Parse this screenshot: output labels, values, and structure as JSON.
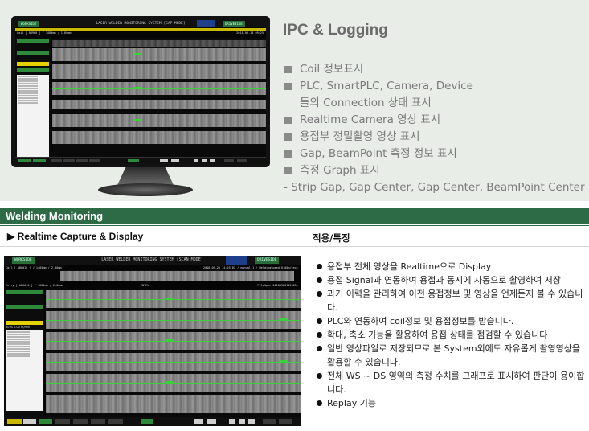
{
  "ipc": {
    "title": "IPC & Logging",
    "items": [
      "Coil 정보표시",
      "PLC, SmartPLC, Camera, Device",
      "들의 Connection 상태 표시",
      "Realtime Camera 영상 표시",
      "용접부 정밀촬영 영상 표시",
      "Gap, BeamPoint 측정 정보 표시",
      "측정 Graph 표시"
    ],
    "subitem": "- Strip Gap, Gap Center, Gap Center, BeamPoint Center"
  },
  "section": {
    "title": "Welding Monitoring",
    "left_subtitle": "▶ Realtime Capture & Display",
    "right_subtitle": "적용/특징"
  },
  "features": [
    "용접부 전체 영상을 Realtime으로 Display",
    "용접 Signal과 연동하여 용접과 동시에 자동으로 촬영하여 저장",
    "과거 이력을 관리하여 이전 용접정보 및 영상을 언제든지 볼 수 있습니다.",
    "PLC와 연동하여 coil정보 및 용접정보를 받습니다.",
    "확대, 축소 기능을 활용하여 용접 상태를 점검할 수 있습니다",
    "일반 영상파일로 저장되므로 본 System외에도 자유롭게 촬영영상을 활용할 수 있습니다.",
    "전체 WS ~ DS 영역의 측정 수치를 그래프로 표시하여 판단이 용이합니다.",
    "Replay 기능"
  ],
  "screen1": {
    "left_tag": "WORKSIDE",
    "right_tag": "DRIVESIDE",
    "title": "LASER WELDER MONITORING SYSTEM [GAP MODE]",
    "info_left": "Coil [ 03960 ] / 1400mm / 1.60mm",
    "info_right": "2018-09-18 09:25"
  },
  "screen2": {
    "left_tag": "WORKSIDE",
    "right_tag": "DRIVESIDE",
    "title": "LASER WELDER MONITORING SYSTEM [SCAN MODE]",
    "info_left": "Coil [ AB0010 ] / 1405mm / 2.50mm",
    "info_right": "2018-09-20 14:25:01 / manual 1 / WeldingSpeed(0.00m/sec)",
    "entry_left": "Entry [ AB0010 ] / 1604mm / 2.00mm",
    "entry_mid": "ENTRY",
    "entry_right": "FileSpec(20180920142501)",
    "speed": "60 %   0.00 m/min"
  },
  "colors": {
    "panel_bg": "#e8ede7",
    "header_green": "#2d6b47",
    "screen_green": "#39d239"
  }
}
